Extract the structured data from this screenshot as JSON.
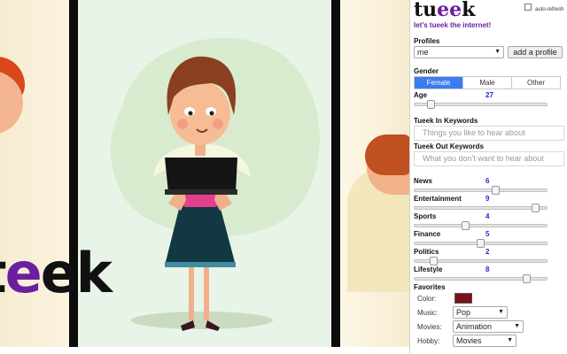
{
  "app": {
    "brand_prefix": "tu",
    "brand_accent": "ee",
    "brand_suffix": "k",
    "tagline": "let's tueek the internet!",
    "auto_refresh_label": "auto-refresh",
    "auto_refresh_checked": false
  },
  "illustration": {
    "logo_prefix": "t",
    "logo_accent": "e",
    "logo_suffix": "ek"
  },
  "profiles": {
    "label": "Profiles",
    "selected": "me",
    "add_button": "add a profile"
  },
  "gender": {
    "label": "Gender",
    "options": [
      "Female",
      "Male",
      "Other"
    ],
    "selected": "Female"
  },
  "age": {
    "label": "Age",
    "value": 27,
    "slider_fraction": 0.1
  },
  "keywords": {
    "in_label": "Tueek In Keywords",
    "in_placeholder": "Things you like to hear about",
    "out_label": "Tueek Out Keywords",
    "out_placeholder": "What you don't want to hear about"
  },
  "interests": [
    {
      "key": "news",
      "label": "News",
      "value": 6,
      "fraction": 0.62
    },
    {
      "key": "entertainment",
      "label": "Entertainment",
      "value": 9,
      "fraction": 0.94
    },
    {
      "key": "sports",
      "label": "Sports",
      "value": 4,
      "fraction": 0.38
    },
    {
      "key": "finance",
      "label": "Finance",
      "value": 5,
      "fraction": 0.5
    },
    {
      "key": "politics",
      "label": "Politics",
      "value": 2,
      "fraction": 0.12
    },
    {
      "key": "lifestyle",
      "label": "Lifestyle",
      "value": 8,
      "fraction": 0.87
    }
  ],
  "favorites": {
    "label": "Favorites",
    "color_label": "Color:",
    "color_value": "#7a1018",
    "music_label": "Music:",
    "music_selected": "Pop",
    "movies_label": "Movies:",
    "movies_selected": "Animation",
    "hobby_label": "Hobby:",
    "hobby_selected": "Movies"
  },
  "colors": {
    "accent_purple": "#6a1fa0",
    "segment_active": "#3b7cf0",
    "value_blue": "#1a2bd0"
  }
}
